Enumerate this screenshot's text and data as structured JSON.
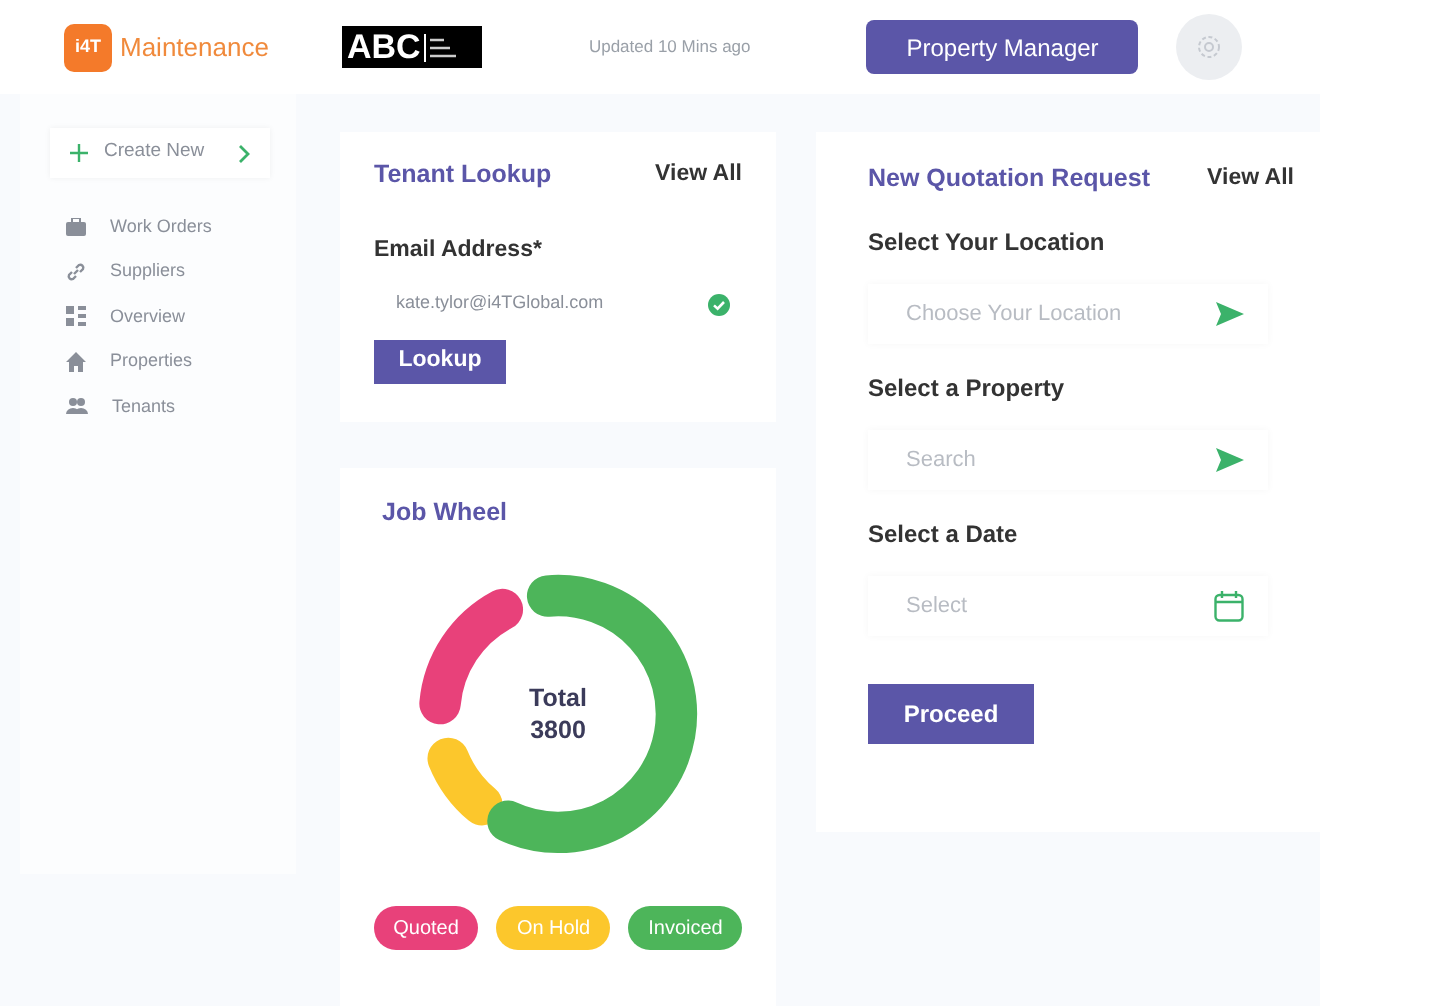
{
  "header": {
    "logo_mark": "i4T",
    "app_name": "Maintenance",
    "brand_logo": {
      "name": "ABC"
    },
    "updated": "Updated 10 Mins ago",
    "role_button": "Property Manager"
  },
  "sidebar": {
    "create_button": "Create New",
    "items": [
      {
        "label": "Work Orders"
      },
      {
        "label": "Suppliers"
      },
      {
        "label": "Overview"
      },
      {
        "label": "Properties"
      },
      {
        "label": "Tenants"
      }
    ]
  },
  "tenant_lookup": {
    "title": "Tenant Lookup",
    "view_all": "View All",
    "field_label": "Email Address*",
    "value": "kate.tylor@i4TGlobal.com",
    "valid": true,
    "button": "Lookup"
  },
  "job_wheel": {
    "title": "Job Wheel",
    "center_label": "Total",
    "center_value": "3800",
    "legend": [
      {
        "label": "Quoted",
        "color": "#e8417a"
      },
      {
        "label": "On Hold",
        "color": "#fcc72c"
      },
      {
        "label": "Invoiced",
        "color": "#4db55a"
      }
    ]
  },
  "quotation": {
    "title": "New Quotation Request",
    "view_all": "View All",
    "fields": [
      {
        "label": "Select Your Location",
        "placeholder": "Choose Your Location",
        "kind": "send"
      },
      {
        "label": "Select a Property",
        "placeholder": "Search",
        "kind": "send"
      },
      {
        "label": "Select a Date",
        "placeholder": "Select",
        "kind": "date"
      }
    ],
    "button": "Proceed"
  }
}
